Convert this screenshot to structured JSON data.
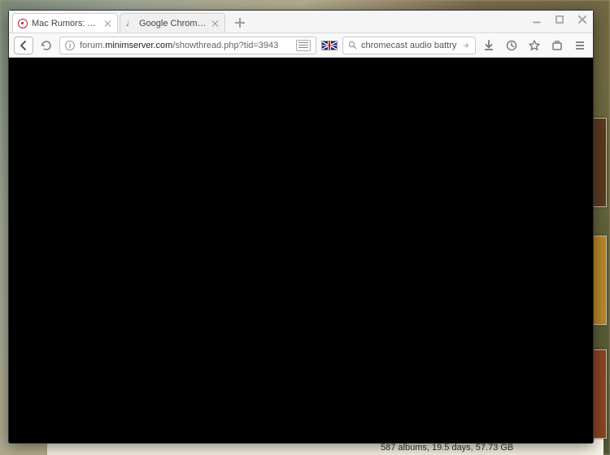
{
  "tabs": [
    {
      "title": "Mac Rumors: Apple Mac iO"
    },
    {
      "title": "Google Chromecast Audio"
    }
  ],
  "url": {
    "host": "minimserver.com",
    "prefix": "forum.",
    "path": "/showthread.php?tid=3943"
  },
  "search": {
    "value": "chromecast audio battry drain"
  },
  "desktop_status": "587 albums, 19.5 days, 57.73 GB"
}
